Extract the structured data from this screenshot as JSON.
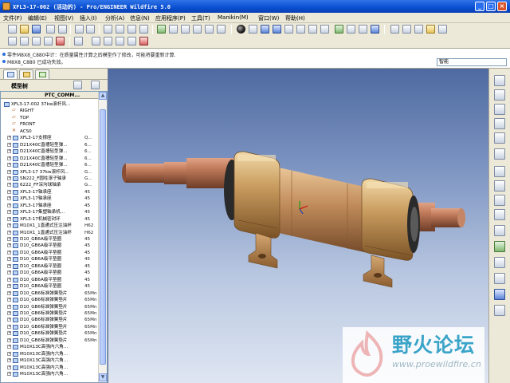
{
  "window": {
    "title": "XFL3-17-002 (活动的) - Pro/ENGINEER Wildfire 5.0",
    "minimize": "_",
    "maximize": "□",
    "close": "×"
  },
  "menu": [
    "文件(F)",
    "编辑(E)",
    "视图(V)",
    "插入(I)",
    "分析(A)",
    "信息(N)",
    "应用程序(P)",
    "工具(T)",
    "Manikin(M)",
    "窗口(W)",
    "帮助(H)"
  ],
  "messages": [
    "零件M8X8_C880中计：在质量属性计算之后模型作了修改，可能将要重新计算.",
    "M8X8_C880 已成功失效。"
  ],
  "smart_filter": "智能",
  "model_tree": {
    "heading": "模型树",
    "column_header": "PTC_COMM...",
    "rows": [
      {
        "label": "XFL3-17-002 37kw滚杆风...",
        "value": "",
        "icon": "asm",
        "exp": ""
      },
      {
        "label": "RIGHT",
        "value": "",
        "icon": "plane",
        "exp": ""
      },
      {
        "label": "TOP",
        "value": "",
        "icon": "plane",
        "exp": ""
      },
      {
        "label": "FRONT",
        "value": "",
        "icon": "plane",
        "exp": ""
      },
      {
        "label": "ACS0",
        "value": "",
        "icon": "csys",
        "exp": ""
      },
      {
        "label": "XFL3-17支撑座",
        "value": "Q...",
        "icon": "part",
        "exp": "+"
      },
      {
        "label": "D21X40C直槽轻型弹...",
        "value": "6...",
        "icon": "part",
        "exp": "+"
      },
      {
        "label": "D21X40C直槽轻型弹...",
        "value": "6...",
        "icon": "part",
        "exp": "+"
      },
      {
        "label": "D21X40C直槽轻型弹...",
        "value": "6...",
        "icon": "part",
        "exp": "+"
      },
      {
        "label": "D21X40C直槽轻型弹...",
        "value": "6...",
        "icon": "part",
        "exp": "+"
      },
      {
        "label": "XFL3-17 37kw滚杆风...",
        "value": "G...",
        "icon": "part",
        "exp": "+"
      },
      {
        "label": "SN222_F圆柱滚子轴承",
        "value": "G...",
        "icon": "part",
        "exp": "+"
      },
      {
        "label": "6222_FF深沟球轴承",
        "value": "G...",
        "icon": "part",
        "exp": "+"
      },
      {
        "label": "XFL3-17轴承座",
        "value": "45",
        "icon": "part",
        "exp": "+"
      },
      {
        "label": "XFL3-17轴承座",
        "value": "45",
        "icon": "part",
        "exp": "+"
      },
      {
        "label": "XFL3-17轴承座",
        "value": "45",
        "icon": "part",
        "exp": "+"
      },
      {
        "label": "XFL3-17集塑轴承机...",
        "value": "45",
        "icon": "part",
        "exp": "+"
      },
      {
        "label": "XFL3-17机械密封环",
        "value": "45",
        "icon": "part",
        "exp": "+"
      },
      {
        "label": "M10X1_1直通式压注油杯",
        "value": "H62",
        "icon": "part",
        "exp": "+"
      },
      {
        "label": "M10X1_1直通式压注油杯",
        "value": "H62",
        "icon": "part",
        "exp": "+"
      },
      {
        "label": "D10_GB6A级平垫圈",
        "value": "45",
        "icon": "part",
        "exp": "+"
      },
      {
        "label": "D10_GB6A级平垫圈",
        "value": "45",
        "icon": "part",
        "exp": "+"
      },
      {
        "label": "D10_GB6A级平垫圈",
        "value": "45",
        "icon": "part",
        "exp": "+"
      },
      {
        "label": "D10_GB6A级平垫圈",
        "value": "45",
        "icon": "part",
        "exp": "+"
      },
      {
        "label": "D10_GB6A级平垫圈",
        "value": "45",
        "icon": "part",
        "exp": "+"
      },
      {
        "label": "D10_GB6A级平垫圈",
        "value": "45",
        "icon": "part",
        "exp": "+"
      },
      {
        "label": "D10_GB6A级平垫圈",
        "value": "45",
        "icon": "part",
        "exp": "+"
      },
      {
        "label": "D10_GB6A级平垫圈",
        "value": "45",
        "icon": "part",
        "exp": "+"
      },
      {
        "label": "D10_GB6标准弹簧垫片",
        "value": "65Mn",
        "icon": "part",
        "exp": "+"
      },
      {
        "label": "D10_GB6标准弹簧垫片",
        "value": "65Mn",
        "icon": "part",
        "exp": "+"
      },
      {
        "label": "D10_GB6标准弹簧垫片",
        "value": "65Mn",
        "icon": "part",
        "exp": "+"
      },
      {
        "label": "D10_GB6标准弹簧垫片",
        "value": "65Mn",
        "icon": "part",
        "exp": "+"
      },
      {
        "label": "D10_GB6标准弹簧垫片",
        "value": "65Mn",
        "icon": "part",
        "exp": "+"
      },
      {
        "label": "D10_GB6标准弹簧垫片",
        "value": "65Mn",
        "icon": "part",
        "exp": "+"
      },
      {
        "label": "D10_GB6标准弹簧垫片",
        "value": "65Mn",
        "icon": "part",
        "exp": "+"
      },
      {
        "label": "D10_GB6标准弹簧垫片",
        "value": "65Mn",
        "icon": "part",
        "exp": "+"
      },
      {
        "label": "M10X13C高强内六角...",
        "value": "",
        "icon": "part",
        "exp": "+"
      },
      {
        "label": "M10X13C高强内六角...",
        "value": "",
        "icon": "part",
        "exp": "+"
      },
      {
        "label": "M10X13C高强内六角...",
        "value": "",
        "icon": "part",
        "exp": "+"
      },
      {
        "label": "M10X13C高强内六角...",
        "value": "",
        "icon": "part",
        "exp": "+"
      },
      {
        "label": "M10X13C高强内六角...",
        "value": "",
        "icon": "part",
        "exp": "+"
      }
    ]
  },
  "watermark": {
    "title": "野火论坛",
    "url": "www.proewildfire.cn"
  },
  "colors": {
    "titlebar": "#0a4fd0",
    "casing": "#c79a5e",
    "shaft": "#a8674a",
    "viewport_top": "#4e6aa0",
    "viewport_bottom": "#dfe6f2"
  }
}
